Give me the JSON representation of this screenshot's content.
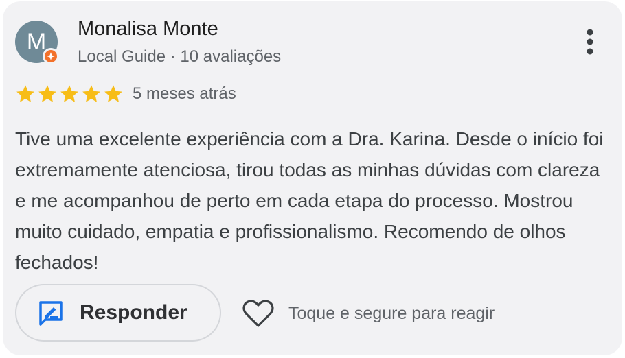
{
  "reviewer": {
    "initial": "M",
    "name": "Monalisa Monte",
    "meta": "Local Guide · 10 avaliações",
    "avatar_color": "#6f8a97",
    "badge_color": "#f3712a",
    "badge_icon": "local-guide-star-icon"
  },
  "review": {
    "rating": 5,
    "max_rating": 5,
    "star_color": "#f7bd18",
    "date": "5 meses atrás",
    "text": "Tive uma excelente experiência com a Dra. Karina. Desde o início foi extremamente atenciosa, tirou todas as minhas dúvidas com clareza e me acompanhou de perto em cada etapa do processo. Mostrou muito cuidado, empatia e profissionalismo. Recomendo de olhos fechados!"
  },
  "actions": {
    "more_icon": "more-vert-icon",
    "reply_label": "Responder",
    "reply_icon": "reply-icon",
    "react_icon": "heart-icon",
    "react_hint": "Toque e segure para reagir",
    "accent_color": "#1a73e8"
  }
}
